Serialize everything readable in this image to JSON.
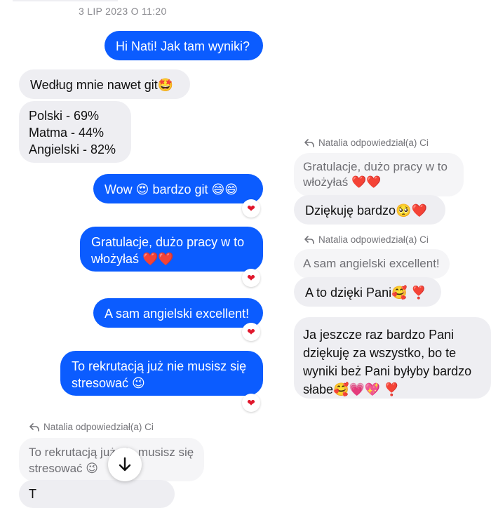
{
  "timestamp": "3 LIP 2023 O 11:20",
  "left": {
    "msg1": "Hi Nati! Jak tam wyniki?",
    "msg2": "Według mnie nawet git🤩",
    "msg3_lines": [
      "Polski - 69%",
      "Matma - 44%",
      "Angielski - 82%"
    ],
    "msg4": "Wow 😍 bardzo git 😄😄",
    "msg5": "Gratulacje, dużo pracy w to włożyłaś ❤️❤️",
    "msg6": "A sam angielski excellent!",
    "msg7": "To rekrutacją już nie musisz się stresować 😉",
    "reply_label": "Natalia odpowiedział(a) Ci",
    "quoted": "To rekrutacją już nie musisz się stresować 😉",
    "partial_bottom": "T"
  },
  "right": {
    "reply_label_1": "Natalia odpowiedział(a) Ci",
    "quoted_1": "Gratulacje, dużo pracy w to włożyłaś ❤️❤️",
    "reply_1": "Dziękuję bardzo🥺❤️",
    "reply_label_2": "Natalia odpowiedział(a) Ci",
    "quoted_2": "A sam angielski excellent!",
    "reply_2": "A to dzięki Pani🥰 ❣️",
    "msg_last": "Ja jeszcze raz bardzo Pani dziękuję za wszystko, bo te wyniki beż Pani byłyby bardzo słabe🥰💗💖 ❣️"
  },
  "reaction_glyph": "❤",
  "icons": {
    "reply": "reply-arrow-icon",
    "scroll": "arrow-down-icon"
  },
  "colors": {
    "outgoing": "#0b5cff",
    "incoming": "#eeeef2",
    "reaction": "#e0162b"
  }
}
